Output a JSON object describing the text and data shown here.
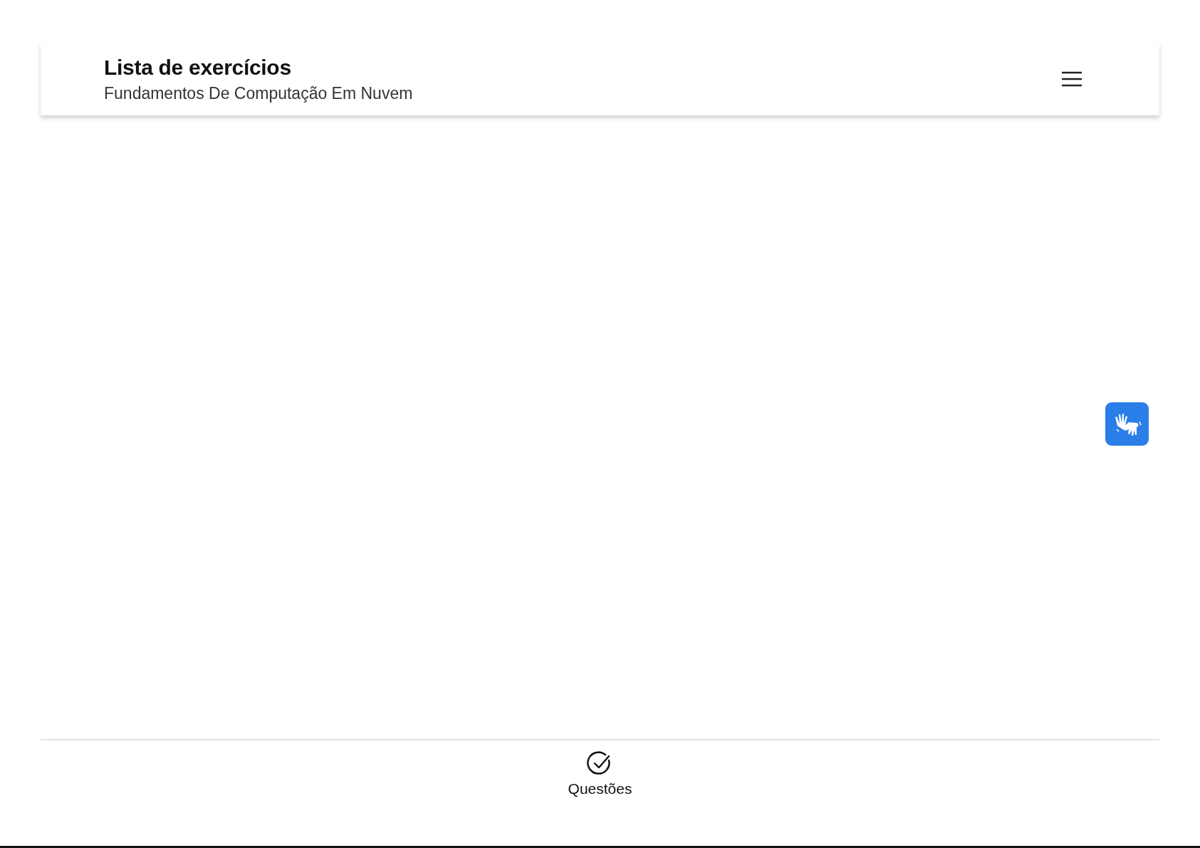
{
  "header": {
    "title": "Lista de exercícios",
    "subtitle": "Fundamentos De Computação Em Nuvem"
  },
  "bottom_nav": [
    {
      "label": "Questões",
      "selected": true
    }
  ]
}
